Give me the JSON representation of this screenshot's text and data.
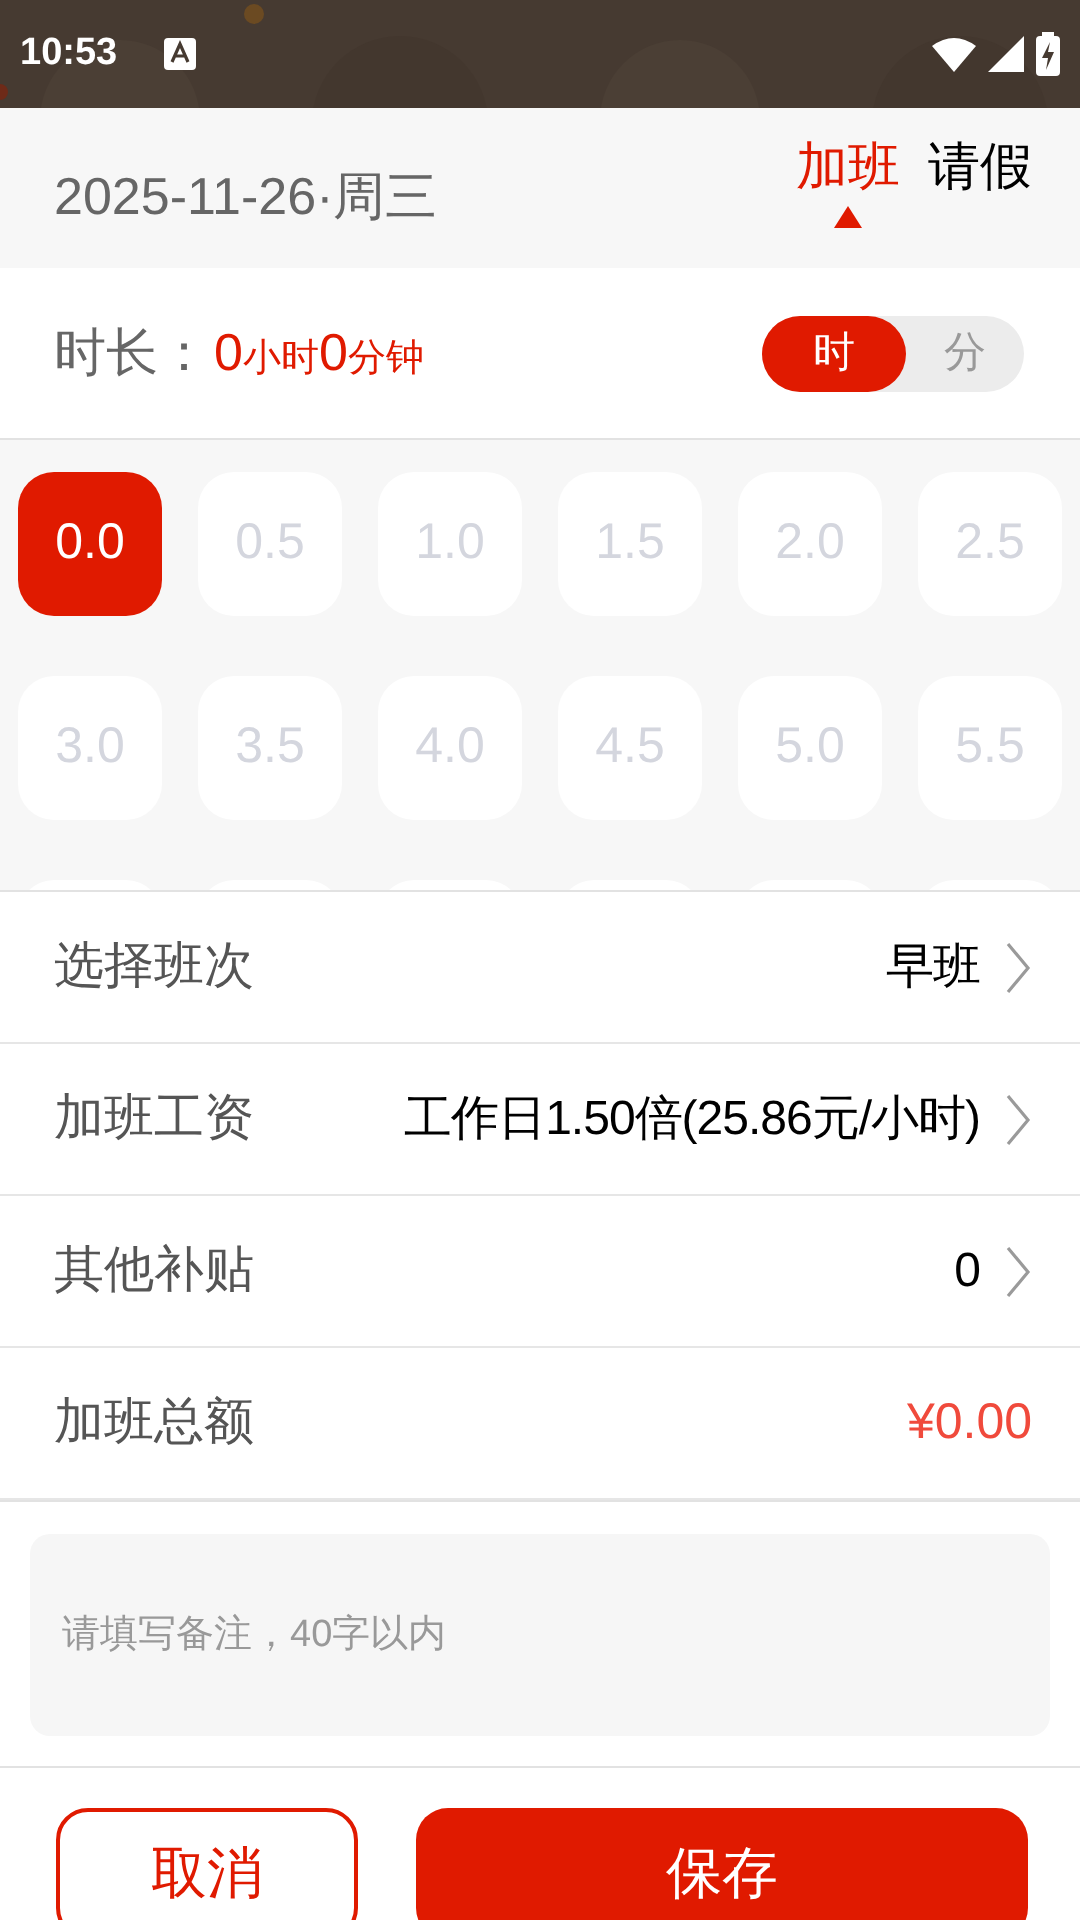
{
  "status_bar": {
    "time": "10:53"
  },
  "header": {
    "date": "2025-11-26·周三",
    "tabs": [
      {
        "label": "加班",
        "selected": true
      },
      {
        "label": "请假",
        "selected": false
      }
    ]
  },
  "duration": {
    "label": "时长：",
    "hours": "0",
    "hours_unit": "小时",
    "minutes": "0",
    "minutes_unit": "分钟",
    "unit_toggle": [
      {
        "label": "时",
        "selected": true
      },
      {
        "label": "分",
        "selected": false
      }
    ]
  },
  "hour_options": [
    {
      "label": "0.0",
      "selected": true
    },
    {
      "label": "0.5",
      "selected": false
    },
    {
      "label": "1.0",
      "selected": false
    },
    {
      "label": "1.5",
      "selected": false
    },
    {
      "label": "2.0",
      "selected": false
    },
    {
      "label": "2.5",
      "selected": false
    },
    {
      "label": "3.0",
      "selected": false
    },
    {
      "label": "3.5",
      "selected": false
    },
    {
      "label": "4.0",
      "selected": false
    },
    {
      "label": "4.5",
      "selected": false
    },
    {
      "label": "5.0",
      "selected": false
    },
    {
      "label": "5.5",
      "selected": false
    }
  ],
  "rows": [
    {
      "kind": "link",
      "label": "选择班次",
      "value": "早班"
    },
    {
      "kind": "link",
      "label": "加班工资",
      "value": "工作日1.50倍(25.86元/小时)"
    },
    {
      "kind": "link",
      "label": "其他补贴",
      "value": "0"
    },
    {
      "kind": "total",
      "label": "加班总额",
      "value": "¥0.00"
    }
  ],
  "note": {
    "placeholder": "请填写备注，40字以内"
  },
  "buttons": [
    {
      "kind": "outline",
      "label": "取消"
    },
    {
      "kind": "filled",
      "label": "保存"
    }
  ]
}
